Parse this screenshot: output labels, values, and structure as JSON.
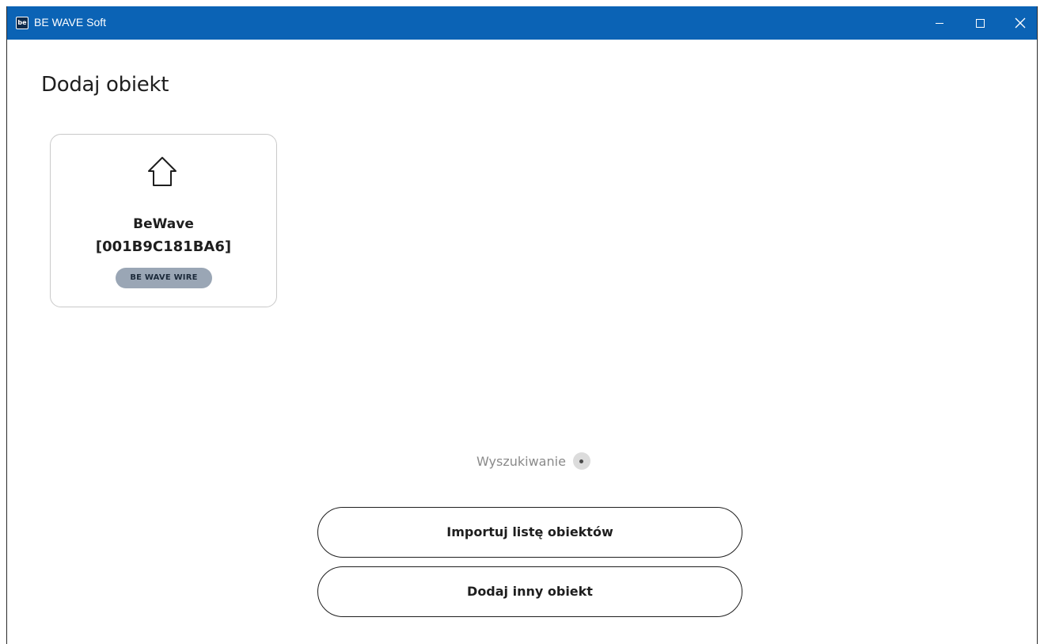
{
  "window": {
    "title": "BE WAVE Soft",
    "icon_text": "be",
    "colors": {
      "titlebar": "#0b63b5",
      "title_text": "#ffffff"
    },
    "controls": {
      "minimize": "minimize-icon",
      "maximize": "maximize-icon",
      "close": "close-icon",
      "close_glyph": "✕"
    }
  },
  "page": {
    "title": "Dodaj obiekt"
  },
  "objects": [
    {
      "icon": "home-icon",
      "name": "BeWave",
      "id": "[001B9C181BA6]",
      "badge": "BE WAVE WIRE"
    }
  ],
  "search": {
    "label": "Wyszukiwanie",
    "icon": "spinner-icon"
  },
  "actions": {
    "import_label": "Importuj listę obiektów",
    "add_other_label": "Dodaj inny obiekt"
  }
}
